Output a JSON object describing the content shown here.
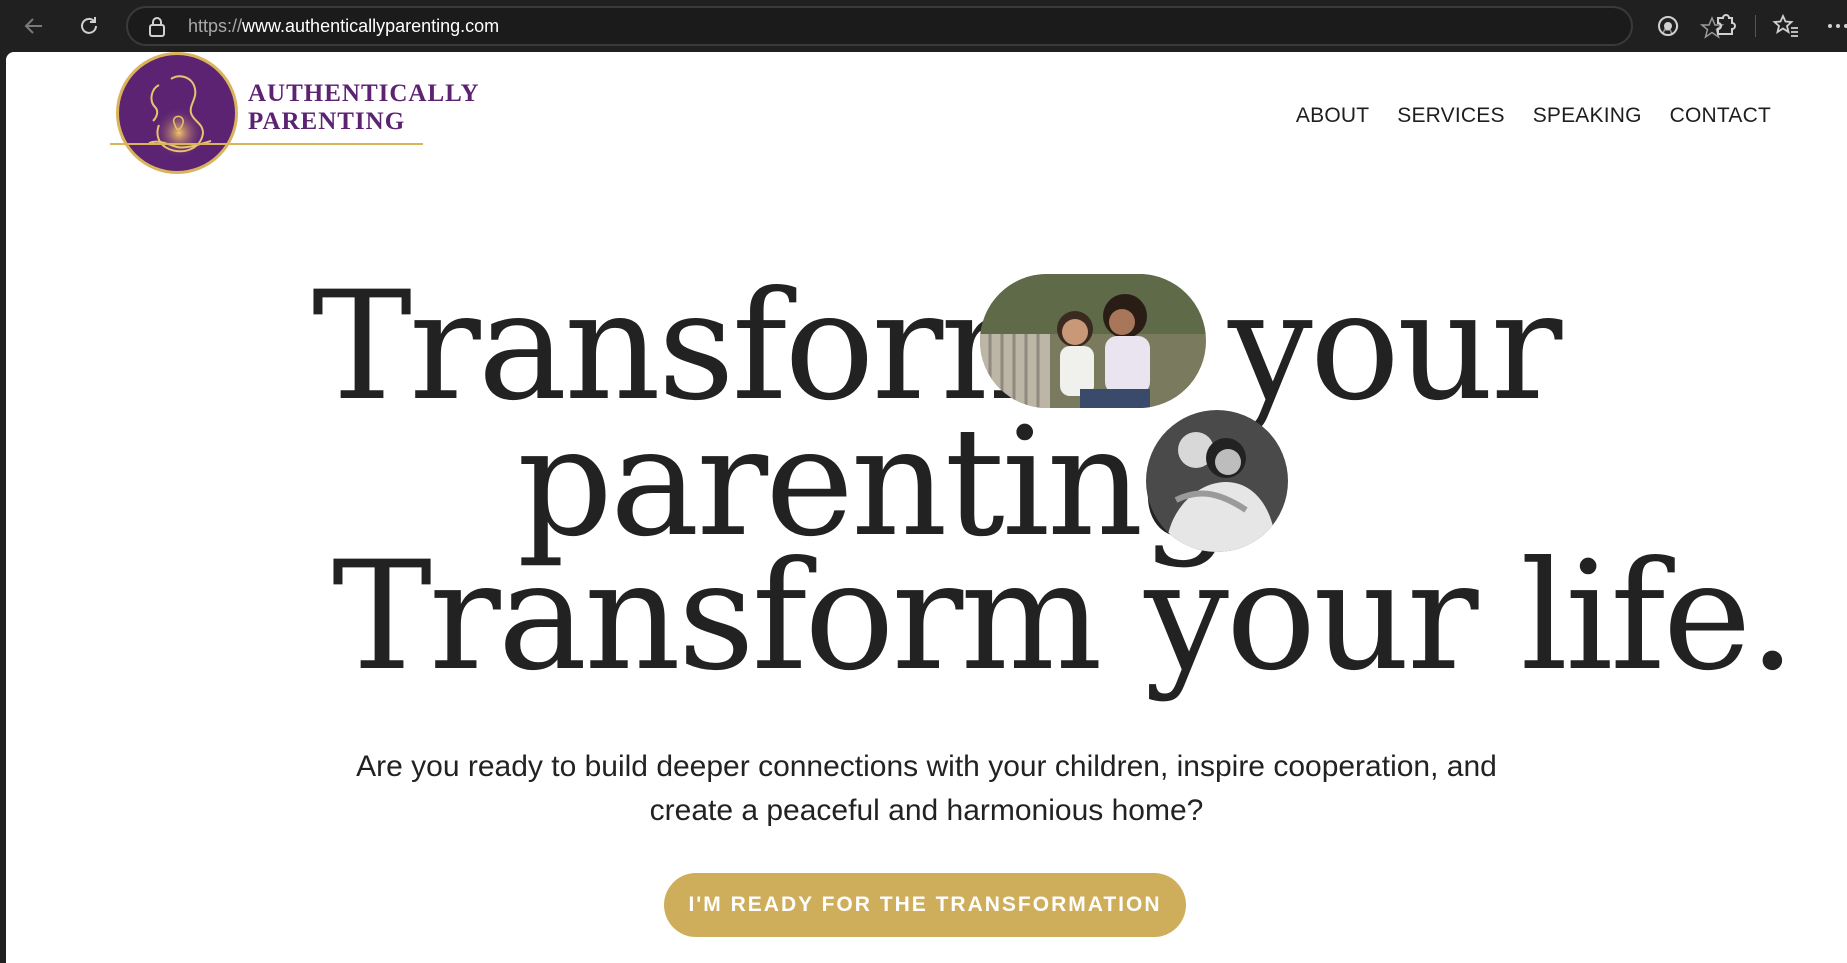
{
  "browser": {
    "url_protocol": "https://",
    "url_host": "www.authenticallyparenting.com"
  },
  "brand": {
    "line1": "AUTHENTICALLY",
    "line2": "PARENTING",
    "purple": "#5c2373",
    "gold": "#cfae5b"
  },
  "nav": {
    "items": [
      "ABOUT",
      "SERVICES",
      "SPEAKING",
      "CONTACT"
    ]
  },
  "hero": {
    "line1_part1": "Transform",
    "line1_part2": "your",
    "line2": "parenting",
    "line3": "Transform your life.",
    "subheading_line1": "Are you ready to build deeper connections with your children, inspire cooperation, and",
    "subheading_line2": "create a peaceful and harmonious home?",
    "cta_label": "I'M READY FOR THE TRANSFORMATION"
  }
}
